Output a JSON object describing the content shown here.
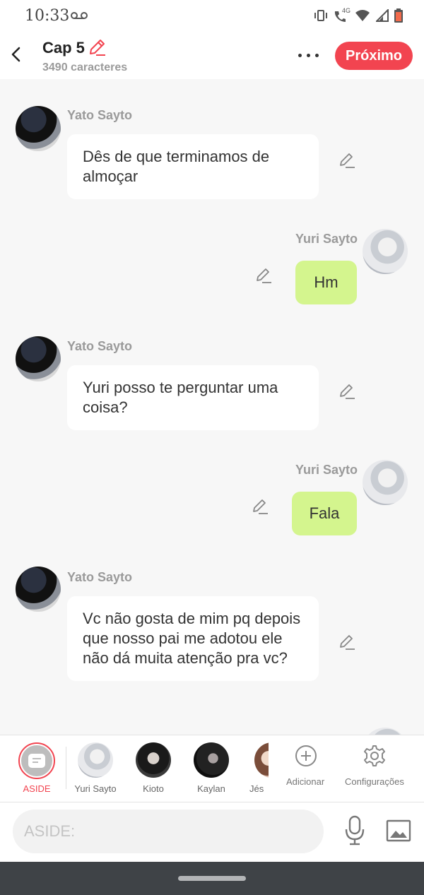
{
  "status_bar": {
    "time": "10:33",
    "icons": [
      "voicemail-icon",
      "vibrate-icon",
      "volte-icon",
      "wifi-icon",
      "signal-icon",
      "battery-icon"
    ],
    "network_label": "4G"
  },
  "header": {
    "title": "Cap 5",
    "subtitle": "3490 caracteres",
    "next_label": "Próximo",
    "accent_color": "#f24450"
  },
  "messages": [
    {
      "side": "left",
      "author": "Yato Sayto",
      "text": "Dês de que terminamos de almoçar"
    },
    {
      "side": "right",
      "author": "Yuri Sayto",
      "text": "Hm"
    },
    {
      "side": "left",
      "author": "Yato Sayto",
      "text": "Yuri posso te perguntar uma coisa?"
    },
    {
      "side": "right",
      "author": "Yuri Sayto",
      "text": "Fala"
    },
    {
      "side": "left",
      "author": "Yato Sayto",
      "text": "Vc não gosta de mim pq depois que nosso pai me adotou ele não dá muita atenção pra vc?"
    }
  ],
  "bubble_colors": {
    "left": "#ffffff",
    "right": "#d4f58e"
  },
  "characters": {
    "aside_label": "ASIDE",
    "items": [
      {
        "label": "Yuri Sayto"
      },
      {
        "label": "Kioto"
      },
      {
        "label": "Kaylan"
      },
      {
        "label": "Jés"
      }
    ],
    "add_label": "Adicionar",
    "settings_label": "Configurações"
  },
  "composer": {
    "placeholder": "ASIDE:"
  }
}
